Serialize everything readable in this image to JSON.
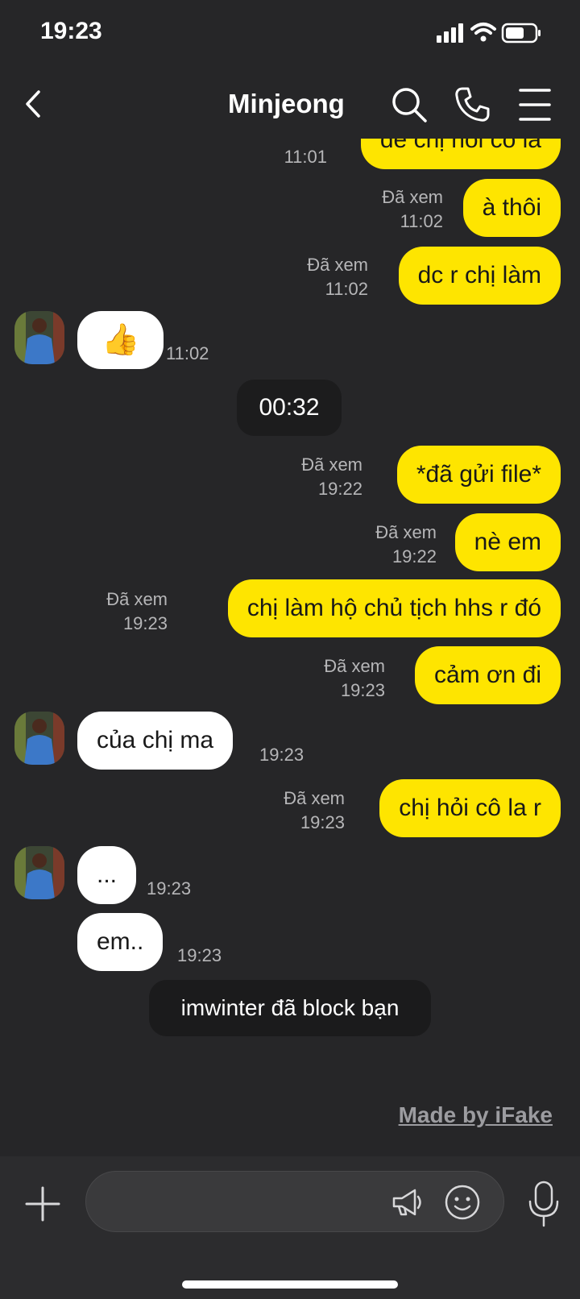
{
  "status_bar": {
    "time": "19:23"
  },
  "header": {
    "title": "Minjeong"
  },
  "messages": {
    "m0": {
      "text": "để chị hỏi cô la",
      "time": "11:01"
    },
    "m1": {
      "text": "à thôi",
      "read": "Đã xem",
      "time": "11:02"
    },
    "m2": {
      "text": "dc r chị làm",
      "read": "Đã xem",
      "time": "11:02"
    },
    "m3": {
      "emoji": "👍",
      "time": "11:02"
    },
    "call": {
      "duration": "00:32"
    },
    "m4": {
      "text": "*đã gửi file*",
      "read": "Đã xem",
      "time": "19:22"
    },
    "m5": {
      "text": "nè em",
      "read": "Đã xem",
      "time": "19:22"
    },
    "m6": {
      "text": "chị làm hộ chủ tịch hhs r đó",
      "read": "Đã xem",
      "time": "19:23"
    },
    "m7": {
      "text": "cảm ơn đi",
      "read": "Đã xem",
      "time": "19:23"
    },
    "m8": {
      "text": "của chị ma",
      "time": "19:23"
    },
    "m9": {
      "text": "chị hỏi cô la r",
      "read": "Đã xem",
      "time": "19:23"
    },
    "m10": {
      "text": "...",
      "time": "19:23"
    },
    "m11": {
      "text": "em..",
      "time": "19:23"
    },
    "system": {
      "text": "imwinter đã block bạn"
    }
  },
  "watermark": "Made by iFake",
  "icons": {
    "back": "chevron-left-icon",
    "search": "search-icon",
    "call": "phone-icon",
    "menu": "menu-icon",
    "plus": "plus-icon",
    "megaphone": "megaphone-icon",
    "emoji": "emoji-icon",
    "mic": "microphone-icon"
  },
  "colors": {
    "background": "#262628",
    "my_bubble": "#fee500",
    "their_bubble": "#ffffff",
    "system_pill": "#1b1b1c"
  }
}
